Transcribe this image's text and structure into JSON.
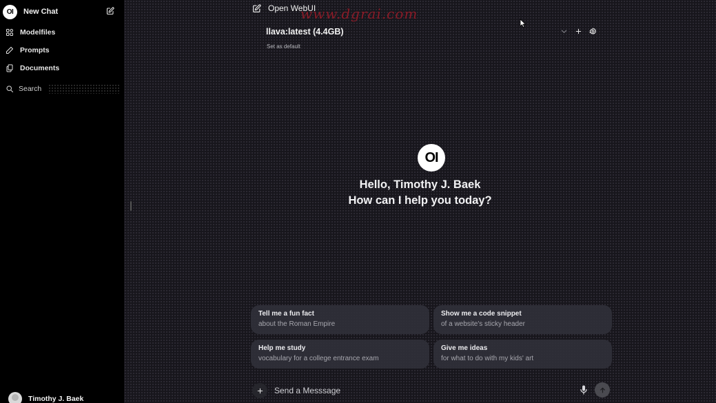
{
  "sidebar": {
    "logo_text": "OI",
    "new_chat_label": "New Chat",
    "items": [
      {
        "label": "Modelfiles",
        "icon": "grid-icon"
      },
      {
        "label": "Prompts",
        "icon": "pencil-icon"
      },
      {
        "label": "Documents",
        "icon": "documents-icon"
      }
    ],
    "search_label": "Search",
    "user_name": "Timothy J. Baek"
  },
  "header": {
    "title": "Open WebUI",
    "watermark": "www.dgrai.com",
    "model_name": "llava:latest (4.4GB)",
    "set_default_label": "Set as default"
  },
  "hero": {
    "logo_text": "OI",
    "greeting_line1": "Hello, Timothy J. Baek",
    "greeting_line2": "How can I help you today?"
  },
  "suggestions": [
    {
      "title": "Tell me a fun fact",
      "subtitle": "about the Roman Empire"
    },
    {
      "title": "Show me a code snippet",
      "subtitle": "of a website's sticky header"
    },
    {
      "title": "Help me study",
      "subtitle": "vocabulary for a college entrance exam"
    },
    {
      "title": "Give me ideas",
      "subtitle": "for what to do with my kids' art"
    }
  ],
  "input": {
    "placeholder": "Send a Messsage"
  },
  "colors": {
    "sidebar_bg": "#000000",
    "main_bg": "#17161c",
    "card_bg": "#303038",
    "watermark": "#8a1b27"
  }
}
